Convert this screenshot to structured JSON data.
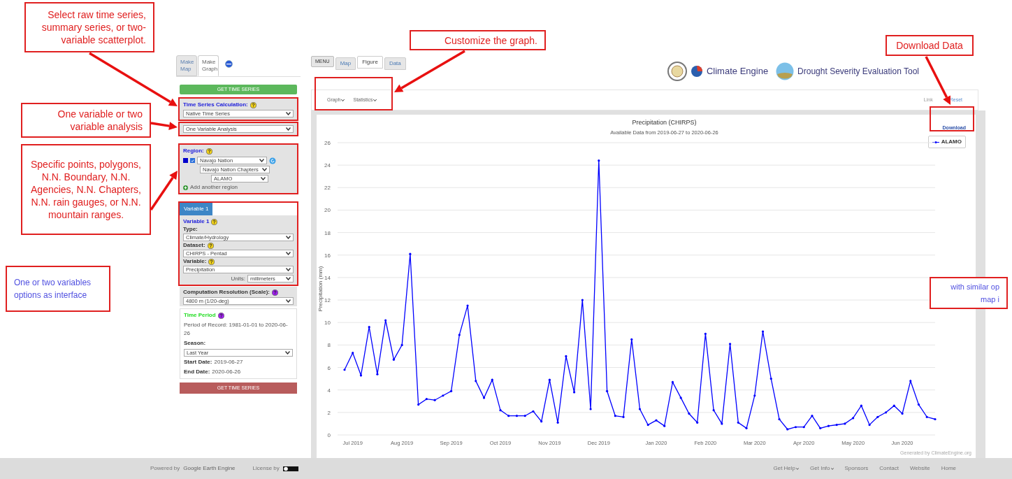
{
  "annotations": [
    {
      "text": "Select raw time series, summary series, or two-variable scatterplot."
    },
    {
      "text": "One variable or two variable analysis"
    },
    {
      "text": "Specific points, polygons, N.N. Boundary, N.N. Agencies, N.N. Chapters, N.N. rain gauges, or N.N. mountain ranges."
    },
    {
      "text": "One or two variables options as interface"
    },
    {
      "text": "Customize the graph."
    },
    {
      "text": "Download Data"
    },
    {
      "text": "with similar op map i"
    }
  ],
  "sidebar": {
    "tabs": [
      {
        "label": "Make Map",
        "selected": false
      },
      {
        "label": "Make Graph",
        "selected": true
      }
    ],
    "get_button": "GET TIME SERIES",
    "time_series_calculation": {
      "label": "Time Series Calculation:",
      "value": "Native Time Series"
    },
    "analysis": {
      "value": "One Variable Analysis"
    },
    "region": {
      "label": "Region:",
      "color": "#0000cc",
      "checked": true,
      "value": "Navajo Nation",
      "sublevel": "Navajo Nation Chapters",
      "feature": "ALAMO",
      "add": "Add another region"
    },
    "variable_tab": "Variable 1",
    "variable": {
      "label": "Variable 1",
      "type_label": "Type:",
      "type": "Climate/Hydrology",
      "dataset_label": "Dataset:",
      "dataset": "CHIRPS - Pentad",
      "variable_label": "Variable:",
      "variable": "Precipitation",
      "units_label": "Units:",
      "units": "millimeters"
    },
    "resolution": {
      "label": "Computation Resolution (Scale):",
      "value": "4800 m (1/20-deg)"
    },
    "time_period": {
      "label": "Time Period",
      "record": "Period of Record: 1981-01-01 to 2020-06-26",
      "season_label": "Season:",
      "season": "Last Year",
      "start_label": "Start Date:",
      "start": "2019-06-27",
      "end_label": "End Date:",
      "end": "2020-06-26"
    },
    "submit_button": "GET TIME SERIES"
  },
  "main": {
    "menu_button": "MENU",
    "tabs": [
      {
        "label": "Map",
        "selected": false
      },
      {
        "label": "Figure",
        "selected": true
      },
      {
        "label": "Data",
        "selected": false
      }
    ],
    "brand": {
      "name": "Climate Engine",
      "tool": "Drought Severity Evaluation Tool"
    },
    "toolbar": {
      "menus": [
        "Graph",
        "Statistics"
      ],
      "links": [
        "Link",
        "Reset"
      ]
    },
    "chart_panel": {
      "download": "Download",
      "subtitle": "Available Data from 2019-06-27 to 2020-06-26",
      "credit": "Generated by ClimateEngine.org",
      "chart_data": {
        "type": "line",
        "title": "Precipitation (CHIRPS)",
        "ylabel": "Precipitation (mm)",
        "grid": true,
        "ylim": [
          0,
          26
        ],
        "yticks": [
          0,
          2,
          4,
          6,
          8,
          10,
          12,
          14,
          16,
          18,
          20,
          22,
          24,
          26
        ],
        "categories": [
          null,
          "Jul 2019",
          null,
          null,
          null,
          null,
          null,
          "Aug 2019",
          null,
          null,
          null,
          null,
          null,
          "Sep 2019",
          null,
          null,
          null,
          null,
          null,
          "Oct 2019",
          null,
          null,
          null,
          null,
          null,
          "Nov 2019",
          null,
          null,
          null,
          null,
          null,
          "Dec 2019",
          null,
          null,
          null,
          null,
          null,
          null,
          "Jan 2020",
          null,
          null,
          null,
          null,
          null,
          "Feb 2020",
          null,
          null,
          null,
          null,
          null,
          "Mar 2020",
          null,
          null,
          null,
          null,
          null,
          "Apr 2020",
          null,
          null,
          null,
          null,
          null,
          "May 2020",
          null,
          null,
          null,
          null,
          null,
          "Jun 2020",
          null,
          null,
          null,
          null
        ],
        "series": [
          {
            "name": "ALAMO",
            "color": "#0000ff",
            "values": [
              5.8,
              7.3,
              5.3,
              9.6,
              5.4,
              10.2,
              6.7,
              8.0,
              16.1,
              2.7,
              3.2,
              3.1,
              3.5,
              3.9,
              8.9,
              11.5,
              4.8,
              3.3,
              4.9,
              2.2,
              1.7,
              1.7,
              1.7,
              2.1,
              1.2,
              4.9,
              1.1,
              7.0,
              3.8,
              12.0,
              2.3,
              24.4,
              3.9,
              1.7,
              1.6,
              8.5,
              2.3,
              0.9,
              1.3,
              0.8,
              4.7,
              3.3,
              1.9,
              1.1,
              9.0,
              2.2,
              1.0,
              8.1,
              1.1,
              0.6,
              3.5,
              9.2,
              5.0,
              1.4,
              0.5,
              0.7,
              0.7,
              1.7,
              0.6,
              0.8,
              0.9,
              1.0,
              1.5,
              2.6,
              0.9,
              1.6,
              2.0,
              2.6,
              1.9,
              4.8,
              2.7,
              1.6,
              1.4
            ]
          }
        ]
      }
    }
  },
  "footer": {
    "powered_by": "Powered by",
    "engine": "Google Earth Engine",
    "license": "License by",
    "links": [
      {
        "label": "Get Help",
        "menu": true
      },
      {
        "label": "Get Info",
        "menu": true
      },
      {
        "label": "Sponsors",
        "menu": false
      },
      {
        "label": "Contact",
        "menu": false
      },
      {
        "label": "Website",
        "menu": false
      },
      {
        "label": "Home",
        "menu": false
      }
    ]
  }
}
